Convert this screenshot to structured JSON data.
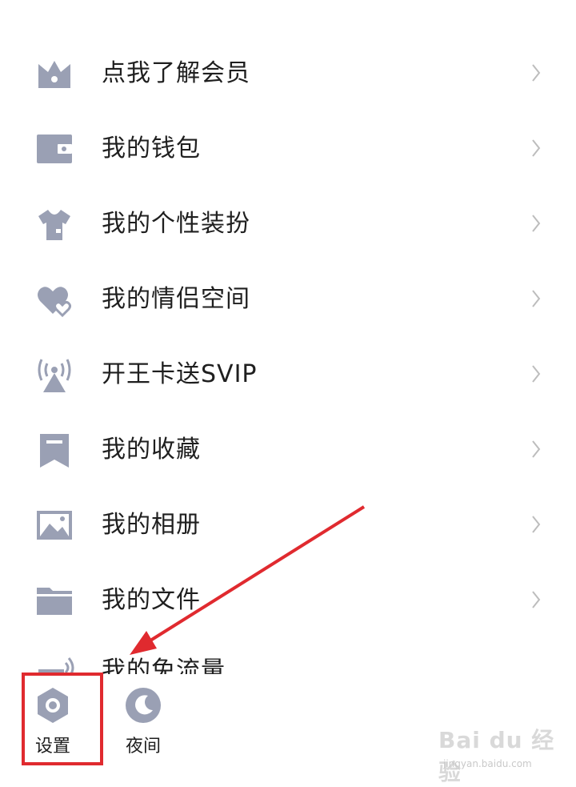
{
  "theme": {
    "icon_color": "#9aa0b4",
    "text_color": "#1f1f1f",
    "chevron_color": "#bdbdbd",
    "highlight_color": "#e02a2f"
  },
  "menu": {
    "items": [
      {
        "label": "点我了解会员",
        "icon": "crown-icon"
      },
      {
        "label": "我的钱包",
        "icon": "wallet-icon"
      },
      {
        "label": "我的个性装扮",
        "icon": "tshirt-icon"
      },
      {
        "label": "我的情侣空间",
        "icon": "couple-hearts-icon"
      },
      {
        "label": "开王卡送SVIP",
        "icon": "signal-tower-icon"
      },
      {
        "label": "我的收藏",
        "icon": "bookmark-icon"
      },
      {
        "label": "我的相册",
        "icon": "photo-album-icon"
      },
      {
        "label": "我的文件",
        "icon": "folder-icon"
      }
    ],
    "partial_item": {
      "label": "我的免流量",
      "icon": "free-data-icon"
    }
  },
  "bottom_bar": {
    "settings_label": "设置",
    "night_label": "夜间"
  },
  "watermark": {
    "brand": "Bai du 经验",
    "url": "jingyan.baidu.com"
  }
}
